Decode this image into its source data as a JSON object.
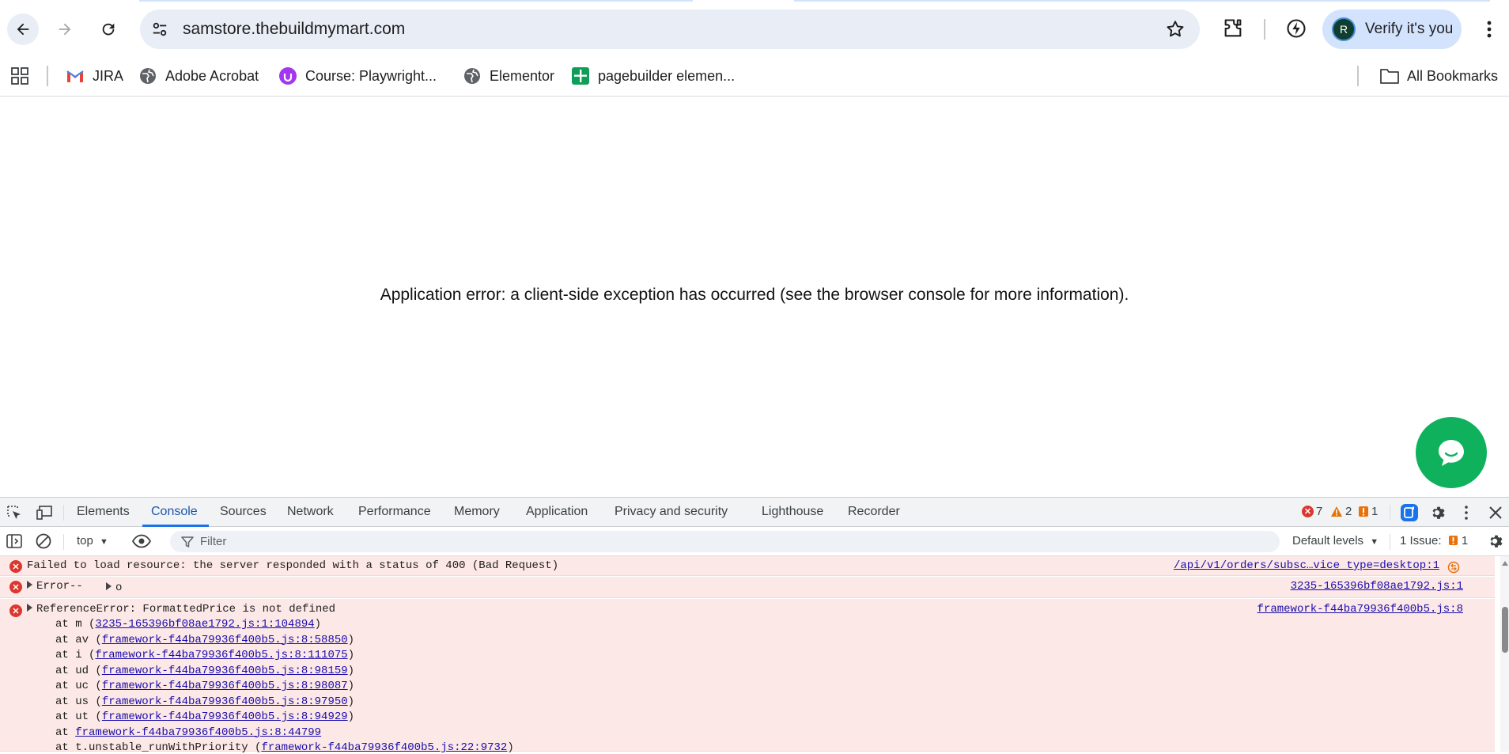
{
  "browser": {
    "url": "samstore.thebuildmymart.com",
    "verify_label": "Verify it's you",
    "avatar_letter": "R"
  },
  "bookmarks": {
    "items": [
      {
        "label": "JIRA",
        "icon": "gmail-icon"
      },
      {
        "label": "Adobe Acrobat",
        "icon": "globe-icon"
      },
      {
        "label": "Course: Playwright...",
        "icon": "udemy-icon"
      },
      {
        "label": "Elementor",
        "icon": "globe-icon"
      },
      {
        "label": "pagebuilder elemen...",
        "icon": "sheets-icon"
      }
    ],
    "all_bookmarks": "All Bookmarks"
  },
  "page": {
    "error_message": "Application error: a client-side exception has occurred (see the browser console for more information)."
  },
  "devtools": {
    "tabs": [
      "Elements",
      "Console",
      "Sources",
      "Network",
      "Performance",
      "Memory",
      "Application",
      "Privacy and security",
      "Lighthouse",
      "Recorder"
    ],
    "active_tab": "Console",
    "error_count": "7",
    "warning_count": "2",
    "issue_badge_count": "1",
    "context": "top",
    "filter_placeholder": "Filter",
    "levels": "Default levels",
    "issues_label": "1 Issue:",
    "issues_count": "1"
  },
  "console": {
    "messages": [
      {
        "text": "Failed to load resource: the server responded with a status of 400 (Bad Request)",
        "source": "/api/v1/orders/subsc…vice_type=desktop:1"
      },
      {
        "text": "Error--",
        "extra": "o",
        "source": "3235-165396bf08ae1792.js:1"
      },
      {
        "text": "ReferenceError: FormattedPrice is not defined",
        "source": "framework-f44ba79936f400b5.js:8"
      }
    ],
    "stack": [
      {
        "prefix": "at m (",
        "link": "3235-165396bf08ae1792.js:1:104894",
        "suffix": ")"
      },
      {
        "prefix": "at av (",
        "link": "framework-f44ba79936f400b5.js:8:58850",
        "suffix": ")"
      },
      {
        "prefix": "at i (",
        "link": "framework-f44ba79936f400b5.js:8:111075",
        "suffix": ")"
      },
      {
        "prefix": "at ud (",
        "link": "framework-f44ba79936f400b5.js:8:98159",
        "suffix": ")"
      },
      {
        "prefix": "at uc (",
        "link": "framework-f44ba79936f400b5.js:8:98087",
        "suffix": ")"
      },
      {
        "prefix": "at us (",
        "link": "framework-f44ba79936f400b5.js:8:97950",
        "suffix": ")"
      },
      {
        "prefix": "at ut (",
        "link": "framework-f44ba79936f400b5.js:8:94929",
        "suffix": ")"
      },
      {
        "prefix": "at ",
        "link": "framework-f44ba79936f400b5.js:8:44799",
        "suffix": ""
      },
      {
        "prefix": "at t.unstable_runWithPriority (",
        "link": "framework-f44ba79936f400b5.js:22:9732",
        "suffix": ")"
      }
    ]
  },
  "colors": {
    "accent": "#1a73e8",
    "error": "#dc362e",
    "warning": "#e37400",
    "chat": "#0fb15d"
  }
}
